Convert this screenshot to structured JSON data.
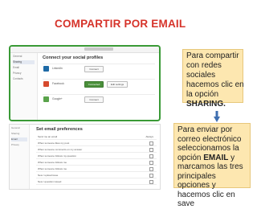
{
  "title": "COMPARTIR POR EMAIL",
  "colors": {
    "title": "#d6332a",
    "frame_green": "#3a9a36",
    "callout_bg": "#fde7b0",
    "arrow": "#3f6fb0"
  },
  "shot1": {
    "header": "Connect your social profiles",
    "sidebar": [
      "General",
      "Sharing",
      "Email",
      "Privacy",
      "Contacts"
    ],
    "rows": [
      {
        "name": "LinkedIn",
        "button": "Connect",
        "icon_color": "#1e6aa6"
      },
      {
        "name": "Facebook",
        "button": "Connected",
        "share": "Edit settings",
        "icon_color": "#d64a2e"
      },
      {
        "name": "Google+",
        "button": "Connect",
        "icon_color": "#5aa34b"
      }
    ]
  },
  "callout1": {
    "text_pre": "Para compartir con redes sociales hacemos clic en la opción ",
    "text_bold": "SHARING."
  },
  "shot2": {
    "header": "Set email preferences",
    "sidebar": [
      "General",
      "Sharing",
      "Email",
      "Privacy"
    ],
    "rows": [
      {
        "label": "Send me an email",
        "value": "Always"
      },
      {
        "label": "When someone likes my post"
      },
      {
        "label": "When someone comments on my answer"
      },
      {
        "label": "When someone follows my question"
      },
      {
        "label": "When someone follows me"
      },
      {
        "label": "When someone follows me"
      },
      {
        "label": "New / upload issue"
      },
      {
        "label": "New / question issued"
      }
    ]
  },
  "callout2": {
    "pre": "Para enviar  por correo electrónico seleccionamos  la opción ",
    "bold": "EMAIL",
    "post": " y marcamos las tres principales opciones y hacemos clic en save"
  }
}
